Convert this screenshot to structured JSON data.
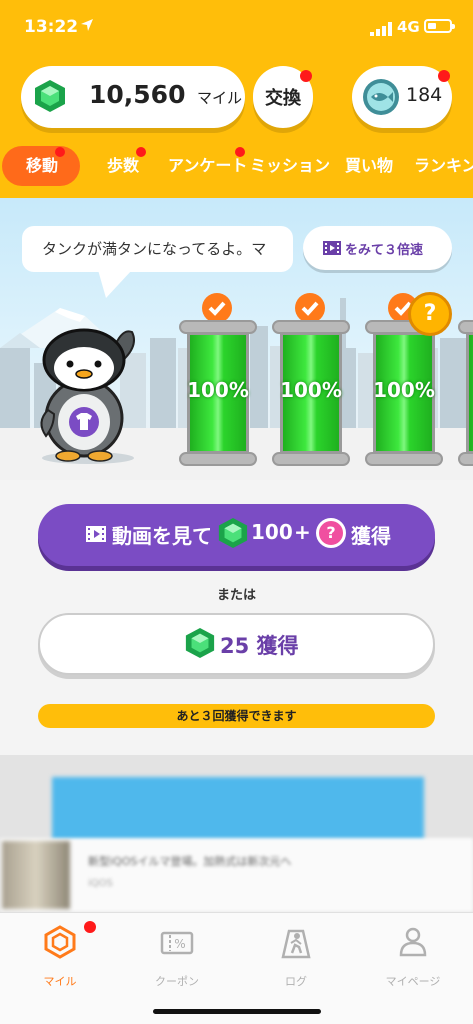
{
  "status_bar": {
    "time": "13:22",
    "network": "4G"
  },
  "wallet": {
    "miles_value": "10,560",
    "miles_unit": "マイル",
    "exchange_label": "交換",
    "coin_value": "184"
  },
  "tabs": [
    "移動",
    "歩数",
    "アンケート",
    "ミッション",
    "買い物",
    "ランキング"
  ],
  "scene": {
    "message": "タンクが満タンになってるよ。マ",
    "speed_button": "をみて３倍速",
    "tanks": [
      {
        "fill_percent": 100,
        "label": "100%"
      },
      {
        "fill_percent": 100,
        "label": "100%"
      },
      {
        "fill_percent": 100,
        "label": "100%"
      }
    ],
    "question_badge": "?"
  },
  "actions": {
    "video_button": {
      "prefix": "動画を見て",
      "amount": "100",
      "plus": "+",
      "question": "?",
      "suffix": "獲得"
    },
    "or_text": "または",
    "plain_button": {
      "label": "25 獲得"
    },
    "remaining_text": "あと３回獲得できます"
  },
  "ad": {
    "title": "新型iQOSイルマ登場。加熱式は新次元へ",
    "sub": "iQOS"
  },
  "bottom_nav": [
    {
      "label": "マイル",
      "icon": "hexagon-icon",
      "active": true
    },
    {
      "label": "クーポン",
      "icon": "coupon-icon",
      "active": false
    },
    {
      "label": "ログ",
      "icon": "walk-icon",
      "active": false
    },
    {
      "label": "マイページ",
      "icon": "user-icon",
      "active": false
    }
  ],
  "colors": {
    "header": "#ffbe0a",
    "active_tab": "#ff6a1a",
    "purple": "#7b4cc4",
    "tank_green": "#2bd42b",
    "badge_red": "#ff1a1a"
  }
}
